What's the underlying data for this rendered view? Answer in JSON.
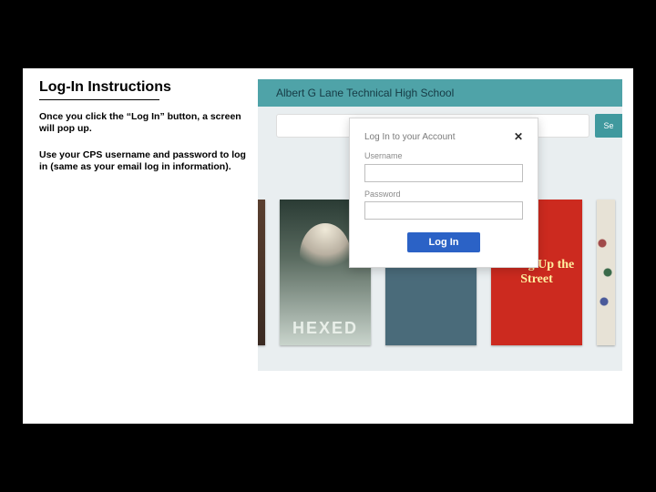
{
  "left": {
    "heading": "Log-In Instructions",
    "para1": "Once you click the “Log In” button, a screen will pop up.",
    "para2": "Use your CPS username and password to log in (same as your email log in information)."
  },
  "topbar": {
    "school": "Albert G Lane Technical High School",
    "search_btn": "Se"
  },
  "modal": {
    "title": "Log In to your Account",
    "close": "✕",
    "username_label": "Username",
    "username_value": "",
    "password_label": "Password",
    "login_btn": "Log In"
  },
  "covers": {
    "hexed": "HEXED",
    "living": "Living Up the Street"
  }
}
